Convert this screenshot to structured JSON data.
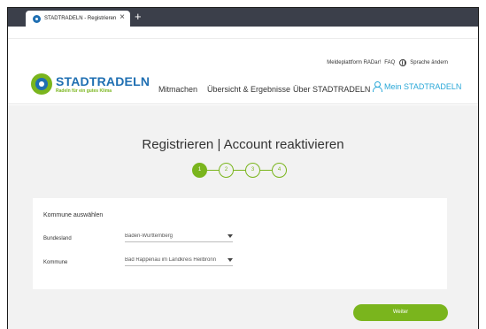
{
  "browser": {
    "tab_title": "STADTRADELN - Registrieren",
    "close_glyph": "×",
    "new_tab_glyph": "+"
  },
  "header": {
    "utility": {
      "meldeplattform": "Meldeplattform RADar!",
      "faq": "FAQ",
      "sprache": "Sprache ändern"
    },
    "logo": {
      "name": "STADTRADELN",
      "tagline": "Radeln für ein gutes Klima"
    },
    "nav": {
      "mitmachen": "Mitmachen",
      "uebersicht": "Übersicht & Ergebnisse",
      "ueber": "Über STADTRADELN",
      "mein": "Mein STADTRADELN"
    }
  },
  "main": {
    "title": "Registrieren  |  Account reaktivieren",
    "steps": [
      "1",
      "2",
      "3",
      "4"
    ],
    "active_step": 1,
    "card": {
      "title": "Kommune auswählen",
      "bundesland_label": "Bundesland",
      "bundesland_value": "Baden-Württemberg",
      "kommune_label": "Kommune",
      "kommune_value": "Bad Rappenau im Landkreis Heilbronn"
    },
    "next_button": "Weiter"
  },
  "colors": {
    "brand_green": "#7ab51d",
    "brand_blue": "#1f6fb2",
    "link_cyan": "#2aa8d8"
  }
}
